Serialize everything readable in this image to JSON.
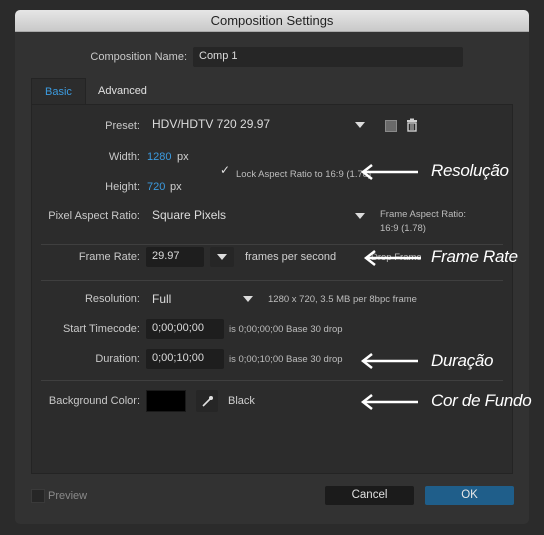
{
  "window": {
    "title": "Composition Settings"
  },
  "composition_name": {
    "label": "Composition Name:",
    "value": "Comp 1"
  },
  "tabs": [
    {
      "label": "Basic",
      "active": true
    },
    {
      "label": "Advanced",
      "active": false
    }
  ],
  "preset": {
    "label": "Preset:",
    "value": "HDV/HDTV 720 29.97"
  },
  "width": {
    "label": "Width:",
    "value": "1280",
    "unit": "px"
  },
  "height": {
    "label": "Height:",
    "value": "720",
    "unit": "px"
  },
  "lock_aspect": {
    "label": "Lock Aspect Ratio to 16:9 (1.78)",
    "checked": true
  },
  "pixel_aspect": {
    "label": "Pixel Aspect Ratio:",
    "value": "Square Pixels",
    "frame_aspect_label": "Frame Aspect Ratio:",
    "frame_aspect_value": "16:9 (1.78)"
  },
  "frame_rate": {
    "label": "Frame Rate:",
    "value": "29.97",
    "unit": "frames per second",
    "drop_label": "Drop Frame"
  },
  "resolution": {
    "label": "Resolution:",
    "value": "Full",
    "info": "1280 x 720, 3.5 MB per 8bpc frame"
  },
  "start_timecode": {
    "label": "Start Timecode:",
    "value": "0;00;00;00",
    "info": "is 0;00;00;00  Base 30  drop"
  },
  "duration": {
    "label": "Duration:",
    "value": "0;00;10;00",
    "info": "is 0;00;10;00  Base 30  drop"
  },
  "background": {
    "label": "Background Color:",
    "value": "Black",
    "swatch": "#000000"
  },
  "footer": {
    "preview": "Preview",
    "cancel": "Cancel",
    "ok": "OK"
  },
  "annotations": {
    "resolucao": "Resolução",
    "frame_rate": "Frame Rate",
    "duracao": "Duração",
    "cor_de_fundo": "Cor de Fundo"
  },
  "colors": {
    "accent": "#3c9bdf",
    "ok_button": "#1f5e8a",
    "background": "#323232"
  }
}
